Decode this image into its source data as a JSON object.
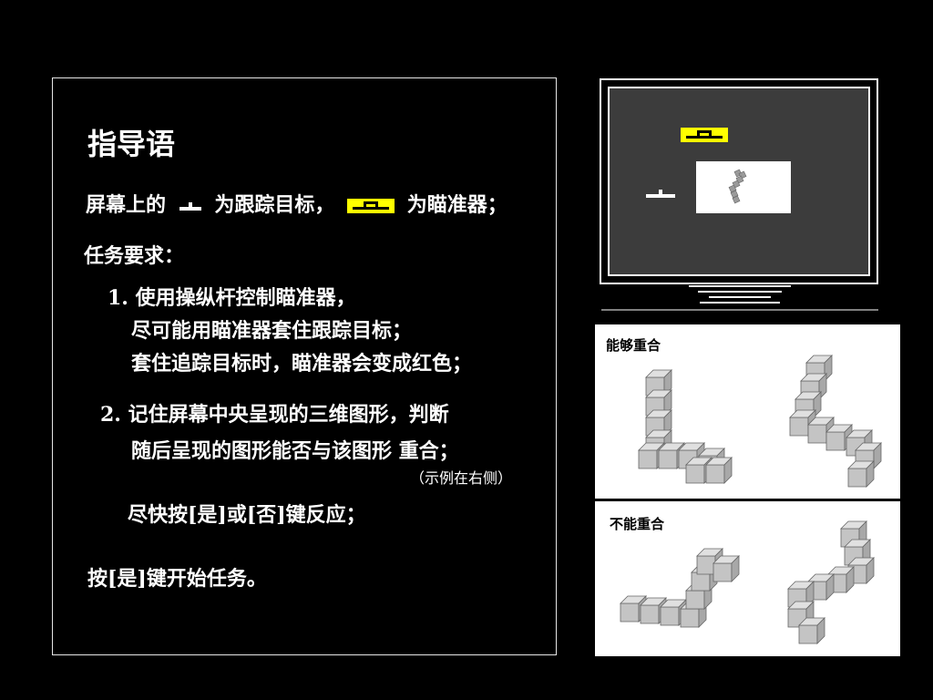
{
  "instructions": {
    "title": "指导语",
    "line1_before": "屏幕上的",
    "line1_middle": "为跟踪目标，",
    "line1_after": "为瞄准器；",
    "task_header": "任务要求：",
    "item1_line1": "1. 使用操纵杆控制瞄准器，",
    "item1_line2": "尽可能用瞄准器套住跟踪目标；",
    "item1_line3": "套住追踪目标时，瞄准器会变成红色；",
    "item2_line1": "2. 记住屏幕中央呈现的三维图形，判断",
    "item2_line2": "随后呈现的图形能否与该图形 重合；",
    "example_note": "（示例在右侧）",
    "item2_line3": "尽快按[是]或[否]键反应；",
    "start_line": "按[是]键开始任务。"
  },
  "examples": {
    "match_label": "能够重合",
    "nonmatch_label": "不能重合"
  },
  "colors": {
    "background": "#000000",
    "reticle": "#ffff00",
    "target": "#ffffff",
    "monitor_screen": "#3c3c3c",
    "cube_face": "#c8c8c8"
  },
  "icons": {
    "target": "target-marker-icon",
    "reticle": "aiming-reticle-icon"
  }
}
